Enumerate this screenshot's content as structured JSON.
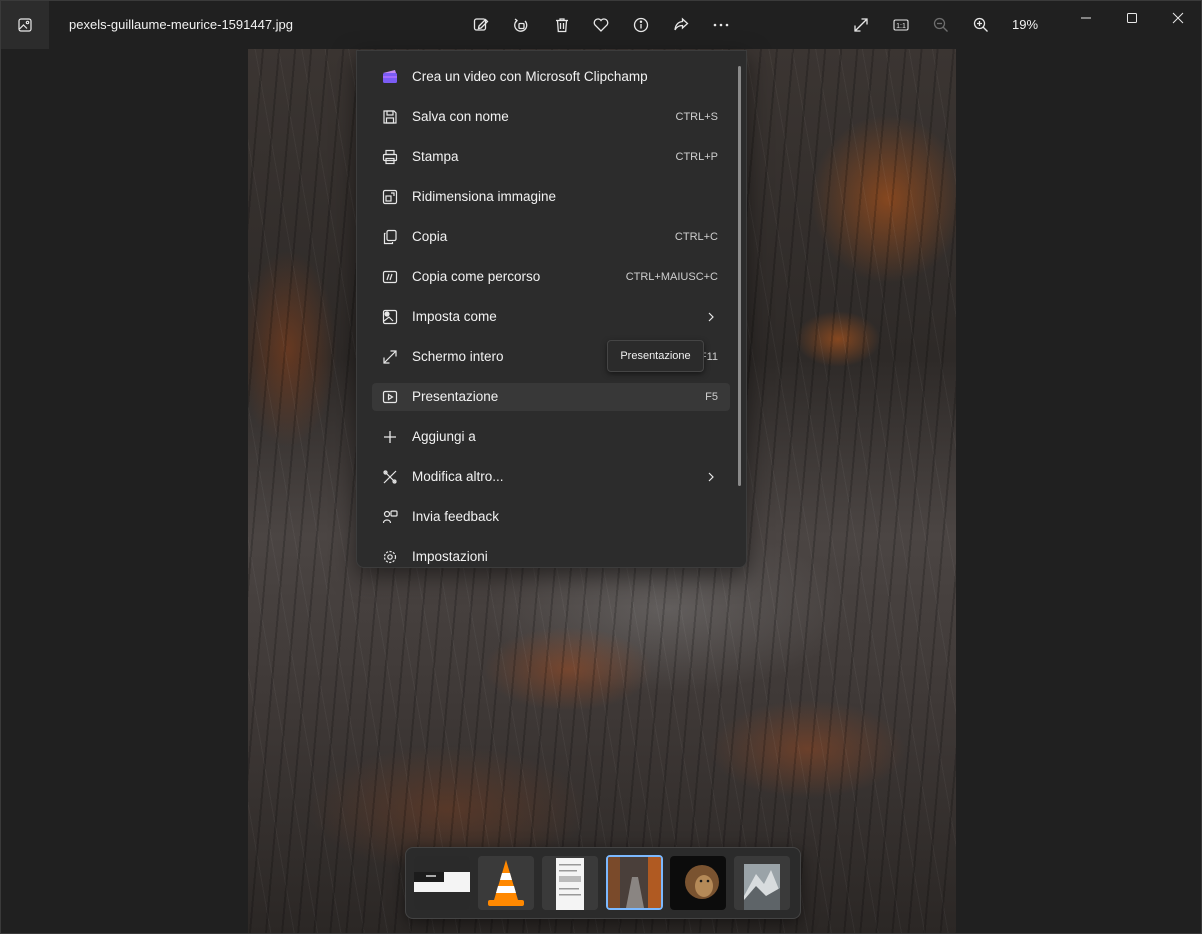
{
  "titlebar": {
    "filename": "pexels-guillaume-meurice-1591447.jpg",
    "zoom_percent": "19%",
    "tools": [
      "edit-icon",
      "rotate-icon",
      "delete-icon",
      "favorite-icon",
      "info-icon",
      "share-icon",
      "more-icon"
    ],
    "actual_size_label": "1:1"
  },
  "menu": {
    "items": [
      {
        "label": "Crea un video con Microsoft Clipchamp",
        "shortcut": "",
        "icon": "clipchamp-icon"
      },
      {
        "label": "Salva con nome",
        "shortcut": "CTRL+S",
        "icon": "save-icon"
      },
      {
        "label": "Stampa",
        "shortcut": "CTRL+P",
        "icon": "print-icon"
      },
      {
        "label": "Ridimensiona immagine",
        "shortcut": "",
        "icon": "resize-icon"
      },
      {
        "label": "Copia",
        "shortcut": "CTRL+C",
        "icon": "copy-icon"
      },
      {
        "label": "Copia come percorso",
        "shortcut": "CTRL+MAIUSC+C",
        "icon": "copy-path-icon"
      },
      {
        "label": "Imposta come",
        "shortcut": "",
        "icon": "set-as-icon",
        "submenu": true
      },
      {
        "label": "Schermo intero",
        "shortcut": "F11",
        "icon": "fullscreen-icon"
      },
      {
        "label": "Presentazione",
        "shortcut": "F5",
        "icon": "slideshow-icon",
        "hovered": true
      },
      {
        "label": "Aggiungi a",
        "shortcut": "",
        "icon": "add-icon"
      },
      {
        "label": "Modifica altro...",
        "shortcut": "",
        "icon": "edit-more-icon",
        "submenu": true
      },
      {
        "label": "Invia feedback",
        "shortcut": "",
        "icon": "feedback-icon"
      },
      {
        "label": "Impostazioni",
        "shortcut": "",
        "icon": "settings-icon"
      }
    ]
  },
  "tooltip": {
    "text": "Presentazione"
  },
  "filmstrip": {
    "thumbnails": [
      {
        "name": "screenshot-thumbnail"
      },
      {
        "name": "vlc-thumbnail"
      },
      {
        "name": "document-thumbnail"
      },
      {
        "name": "autumn-path-thumbnail",
        "selected": true
      },
      {
        "name": "lion-thumbnail"
      },
      {
        "name": "mountain-thumbnail"
      }
    ]
  },
  "colors": {
    "background": "#202020",
    "menu_background": "#2c2c2c",
    "selected_border": "#7cb9ff",
    "accent_orange": "#c8561c"
  }
}
